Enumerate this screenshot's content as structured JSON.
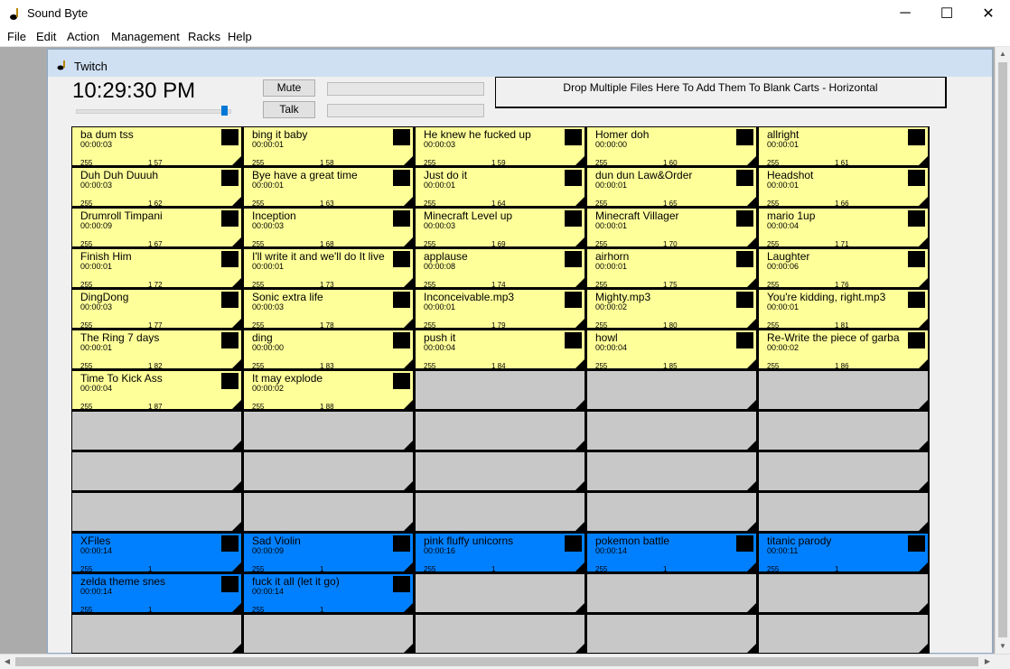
{
  "app": {
    "title": "Sound Byte"
  },
  "menu": [
    "File",
    "Edit",
    "Action",
    "Management",
    "Racks",
    "Help"
  ],
  "window_controls": {
    "minimize": "─",
    "maximize": "☐",
    "close": "✕"
  },
  "child": {
    "title": "Twitch"
  },
  "clock": "10:29:30 PM",
  "volume_level": 0.97,
  "buttons": {
    "mute": "Mute",
    "talk": "Talk"
  },
  "dropzone": "Drop Multiple Files Here To Add Them To Blank Carts - Horizontal",
  "colors": {
    "yellow": "#ffff99",
    "blue": "#0080ff",
    "empty": "#c8c8c8"
  },
  "carts": [
    {
      "title": "ba dum tss",
      "time": "00:00:03",
      "vol": "255",
      "num": "1 57",
      "color": "yellow"
    },
    {
      "title": "bing it baby",
      "time": "00:00:01",
      "vol": "255",
      "num": "1 58",
      "color": "yellow"
    },
    {
      "title": "He knew he fucked up",
      "time": "00:00:03",
      "vol": "255",
      "num": "1 59",
      "color": "yellow"
    },
    {
      "title": "Homer doh",
      "time": "00:00:00",
      "vol": "255",
      "num": "1 60",
      "color": "yellow"
    },
    {
      "title": "allright",
      "time": "00:00:01",
      "vol": "255",
      "num": "1 61",
      "color": "yellow"
    },
    {
      "title": "Duh Duh Duuuh",
      "time": "00:00:03",
      "vol": "255",
      "num": "1 62",
      "color": "yellow"
    },
    {
      "title": "Bye have a great time",
      "time": "00:00:01",
      "vol": "255",
      "num": "1 63",
      "color": "yellow"
    },
    {
      "title": "Just do it",
      "time": "00:00:01",
      "vol": "255",
      "num": "1 64",
      "color": "yellow"
    },
    {
      "title": "dun dun Law&Order",
      "time": "00:00:01",
      "vol": "255",
      "num": "1 65",
      "color": "yellow"
    },
    {
      "title": "Headshot",
      "time": "00:00:01",
      "vol": "255",
      "num": "1 66",
      "color": "yellow"
    },
    {
      "title": "Drumroll Timpani",
      "time": "00:00:09",
      "vol": "255",
      "num": "1 67",
      "color": "yellow"
    },
    {
      "title": "Inception",
      "time": "00:00:03",
      "vol": "255",
      "num": "1 68",
      "color": "yellow"
    },
    {
      "title": "Minecraft Level up",
      "time": "00:00:03",
      "vol": "255",
      "num": "1 69",
      "color": "yellow"
    },
    {
      "title": "Minecraft Villager",
      "time": "00:00:01",
      "vol": "255",
      "num": "1 70",
      "color": "yellow"
    },
    {
      "title": "mario 1up",
      "time": "00:00:04",
      "vol": "255",
      "num": "1 71",
      "color": "yellow"
    },
    {
      "title": "Finish Him",
      "time": "00:00:01",
      "vol": "255",
      "num": "1 72",
      "color": "yellow"
    },
    {
      "title": "I'll write it and we'll do It live",
      "time": "00:00:01",
      "vol": "255",
      "num": "1 73",
      "color": "yellow"
    },
    {
      "title": "applause",
      "time": "00:00:08",
      "vol": "255",
      "num": "1 74",
      "color": "yellow"
    },
    {
      "title": "airhorn",
      "time": "00:00:01",
      "vol": "255",
      "num": "1 75",
      "color": "yellow"
    },
    {
      "title": "Laughter",
      "time": "00:00:06",
      "vol": "255",
      "num": "1 76",
      "color": "yellow"
    },
    {
      "title": "DingDong",
      "time": "00:00:03",
      "vol": "255",
      "num": "1 77",
      "color": "yellow"
    },
    {
      "title": "Sonic extra life",
      "time": "00:00:03",
      "vol": "255",
      "num": "1 78",
      "color": "yellow"
    },
    {
      "title": "Inconceivable.mp3",
      "time": "00:00:01",
      "vol": "255",
      "num": "1 79",
      "color": "yellow"
    },
    {
      "title": "Mighty.mp3",
      "time": "00:00:02",
      "vol": "255",
      "num": "1 80",
      "color": "yellow"
    },
    {
      "title": "You're kidding, right.mp3",
      "time": "00:00:01",
      "vol": "255",
      "num": "1 81",
      "color": "yellow"
    },
    {
      "title": "The Ring 7 days",
      "time": "00:00:01",
      "vol": "255",
      "num": "1 82",
      "color": "yellow"
    },
    {
      "title": "ding",
      "time": "00:00:00",
      "vol": "255",
      "num": "1 83",
      "color": "yellow"
    },
    {
      "title": "push it",
      "time": "00:00:04",
      "vol": "255",
      "num": "1 84",
      "color": "yellow"
    },
    {
      "title": "howl",
      "time": "00:00:04",
      "vol": "255",
      "num": "1 85",
      "color": "yellow"
    },
    {
      "title": "Re-Write the piece of garba",
      "time": "00:00:02",
      "vol": "255",
      "num": "1 86",
      "color": "yellow"
    },
    {
      "title": "Time To Kick Ass",
      "time": "00:00:04",
      "vol": "255",
      "num": "1 87",
      "color": "yellow"
    },
    {
      "title": "It may explode",
      "time": "00:00:02",
      "vol": "255",
      "num": "1 88",
      "color": "yellow"
    },
    {
      "color": "empty"
    },
    {
      "color": "empty"
    },
    {
      "color": "empty"
    },
    {
      "color": "empty"
    },
    {
      "color": "empty"
    },
    {
      "color": "empty"
    },
    {
      "color": "empty"
    },
    {
      "color": "empty"
    },
    {
      "color": "empty"
    },
    {
      "color": "empty"
    },
    {
      "color": "empty"
    },
    {
      "color": "empty"
    },
    {
      "color": "empty"
    },
    {
      "color": "empty"
    },
    {
      "color": "empty"
    },
    {
      "color": "empty"
    },
    {
      "color": "empty"
    },
    {
      "color": "empty"
    },
    {
      "title": "XFiles",
      "time": "00:00:14",
      "vol": "255",
      "num": "1",
      "color": "blue"
    },
    {
      "title": "Sad Violin",
      "time": "00:00:09",
      "vol": "255",
      "num": "1",
      "color": "blue"
    },
    {
      "title": "pink fluffy unicorns",
      "time": "00:00:16",
      "vol": "255",
      "num": "1",
      "color": "blue"
    },
    {
      "title": "pokemon battle",
      "time": "00:00:14",
      "vol": "255",
      "num": "1",
      "color": "blue"
    },
    {
      "title": "titanic parody",
      "time": "00:00:11",
      "vol": "255",
      "num": "1",
      "color": "blue"
    },
    {
      "title": "zelda theme snes",
      "time": "00:00:14",
      "vol": "255",
      "num": "1",
      "color": "blue"
    },
    {
      "title": "fuck it all (let it go)",
      "time": "00:00:14",
      "vol": "255",
      "num": "1",
      "color": "blue"
    },
    {
      "color": "empty"
    },
    {
      "color": "empty"
    },
    {
      "color": "empty"
    },
    {
      "color": "empty"
    },
    {
      "color": "empty"
    },
    {
      "color": "empty"
    },
    {
      "color": "empty"
    },
    {
      "color": "empty"
    }
  ]
}
